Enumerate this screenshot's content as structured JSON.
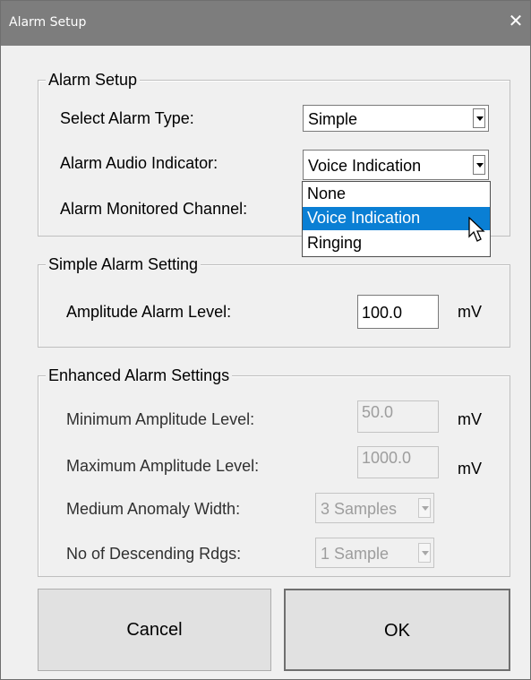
{
  "window": {
    "title": "Alarm Setup",
    "close_icon": "close-icon"
  },
  "alarm_setup": {
    "legend": "Alarm Setup",
    "type_label": "Select Alarm Type:",
    "type_value": "Simple",
    "audio_label": "Alarm Audio Indicator:",
    "audio_value": "Voice Indication",
    "channel_label": "Alarm Monitored Channel:",
    "audio_options": [
      "None",
      "Voice Indication",
      "Ringing"
    ],
    "audio_selected_option": "Voice Indication"
  },
  "simple": {
    "legend": "Simple Alarm Setting",
    "amp_label": "Amplitude Alarm Level:",
    "amp_value": "100.0",
    "unit": "mV"
  },
  "enhanced": {
    "legend": "Enhanced Alarm Settings",
    "min_label": "Minimum Amplitude Level:",
    "min_value": "50.0",
    "min_unit": "mV",
    "max_label": "Maximum Amplitude Level:",
    "max_value": "1000.0",
    "max_unit": "mV",
    "width_label": "Medium Anomaly Width:",
    "width_value": "3 Samples",
    "desc_label": "No of Descending Rdgs:",
    "desc_value": "1 Sample"
  },
  "buttons": {
    "cancel": "Cancel",
    "ok": "OK"
  },
  "colors": {
    "titlebar": "#7d7d7d",
    "selection": "#0a7fd4",
    "dialog_bg": "#f0f0f0"
  },
  "icons": [
    "close-icon",
    "chevron-down-icon",
    "mouse-pointer-icon"
  ]
}
